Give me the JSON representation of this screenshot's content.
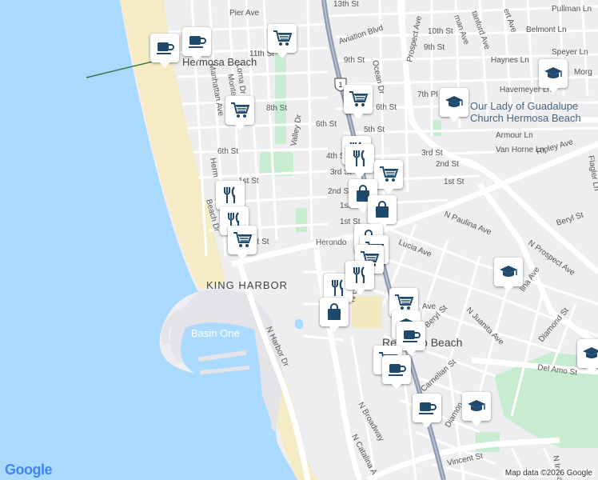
{
  "map": {
    "attribution": "Map data ©2026 Google",
    "logo_text": "Google",
    "colors": {
      "water": "#aadaff",
      "land": "#eeeef1",
      "beach": "#f5ebc4",
      "park": "#c8ecd0",
      "road": "#ffffff",
      "highway": "#8d99ae",
      "marker_icon": "#1f4a6e"
    }
  },
  "places": {
    "hermosa": "Hermosa Beach",
    "king_harbor": "KING HARBOR",
    "basin_one": "Basin One",
    "redondo": "Redondo Beach",
    "church": "Our Lady of Guadalupe Church Hermosa Beach"
  },
  "streets": {
    "pier_ave": "Pier Ave",
    "aviation_blvd": "Aviation Blvd",
    "s13": "13th St",
    "s11": "11th St",
    "s10": "10th St",
    "s9": "9th St",
    "s9b": "9th St",
    "s8": "8th St",
    "s7pl": "7th Pl",
    "s6a": "6th St",
    "s6b": "6th St",
    "s6c": "6th St",
    "s5": "5th St",
    "s4": "4th St",
    "s3a": "3rd St",
    "s3b": "3rd St",
    "s2a": "2nd St",
    "s2b": "2nd St",
    "s1a": "1st St",
    "s1b": "1st St",
    "s1c": "1st St",
    "s1d": "1st St",
    "s1e": "1st St",
    "valley_dr": "Valley Dr",
    "loma_dr": "Loma Dr",
    "manhattan_ave": "Manhattan Ave",
    "monterey": "Monte",
    "herondo": "Herondo",
    "herm": "Herm",
    "beach_dr": "Beach Dr",
    "ocean_dr": "Ocean Dr",
    "prospect_ave": "Prospect Ave",
    "pullman_ln": "Pullman Ln",
    "belmont_ln": "Belmont Ln",
    "haynes_ln": "Haynes Ln",
    "speyer_ln": "Speyer Ln",
    "havemeyer_ln": "Havemeyer Ln",
    "armour_ln": "Armour Ln",
    "van_horne_ln": "Van Horne Ln",
    "ripley_ave": "Ripley Ave",
    "flagler_ln": "Flagler Ln",
    "morg": "Morg",
    "n_paulina_ave": "N Paulina Ave",
    "beryl_st": "Beryl St",
    "beryl_st2": "Beryl St",
    "n_prospect_ave": "N Prospect Ave",
    "lucia_ave": "Lucia Ave",
    "n_juanita_ave": "N Juanita Ave",
    "diamond_st": "Diamond St",
    "diamond_st2": "Diamon",
    "del_amo_st": "Del Amo St",
    "carnelian_st": "Carnelian St",
    "vincent_st": "Vincent St",
    "n_harbor_dr": "N Harbor Dr",
    "n_broadway": "N Broadway",
    "n_catalina": "N Catalina A",
    "n_ca": "N Ca",
    "n_irena": "N Irena",
    "man_ave": "man Ave",
    "tanford_ave": "tanford Ave",
    "ert_ave": "ert Ave",
    "lina_ave": "lina Ave",
    "n_ave": "N",
    "ave": "Ave",
    "route_1": "1"
  },
  "markers": [
    {
      "type": "cafe-icon"
    },
    {
      "type": "cafe-icon"
    },
    {
      "type": "shopping-cart-icon"
    },
    {
      "type": "shopping-cart-icon"
    },
    {
      "type": "shopping-cart-icon"
    },
    {
      "type": "school-icon"
    },
    {
      "type": "school-icon"
    },
    {
      "type": "restaurant-icon"
    },
    {
      "type": "restaurant-icon"
    },
    {
      "type": "shopping-cart-icon"
    },
    {
      "type": "restaurant-icon"
    },
    {
      "type": "restaurant-icon"
    },
    {
      "type": "shopping-cart-icon"
    },
    {
      "type": "shopping-bag-icon"
    },
    {
      "type": "shopping-bag-icon"
    },
    {
      "type": "shopping-bag-icon"
    },
    {
      "type": "shopping-cart-icon"
    },
    {
      "type": "shopping-cart-icon"
    },
    {
      "type": "restaurant-icon"
    },
    {
      "type": "restaurant-icon"
    },
    {
      "type": "shopping-bag-icon"
    },
    {
      "type": "school-icon"
    },
    {
      "type": "shopping-cart-icon"
    },
    {
      "type": "school-icon"
    },
    {
      "type": "cafe-icon"
    },
    {
      "type": "shopping-cart-icon"
    },
    {
      "type": "cafe-icon"
    },
    {
      "type": "cafe-icon"
    },
    {
      "type": "school-icon"
    },
    {
      "type": "school-icon"
    }
  ]
}
